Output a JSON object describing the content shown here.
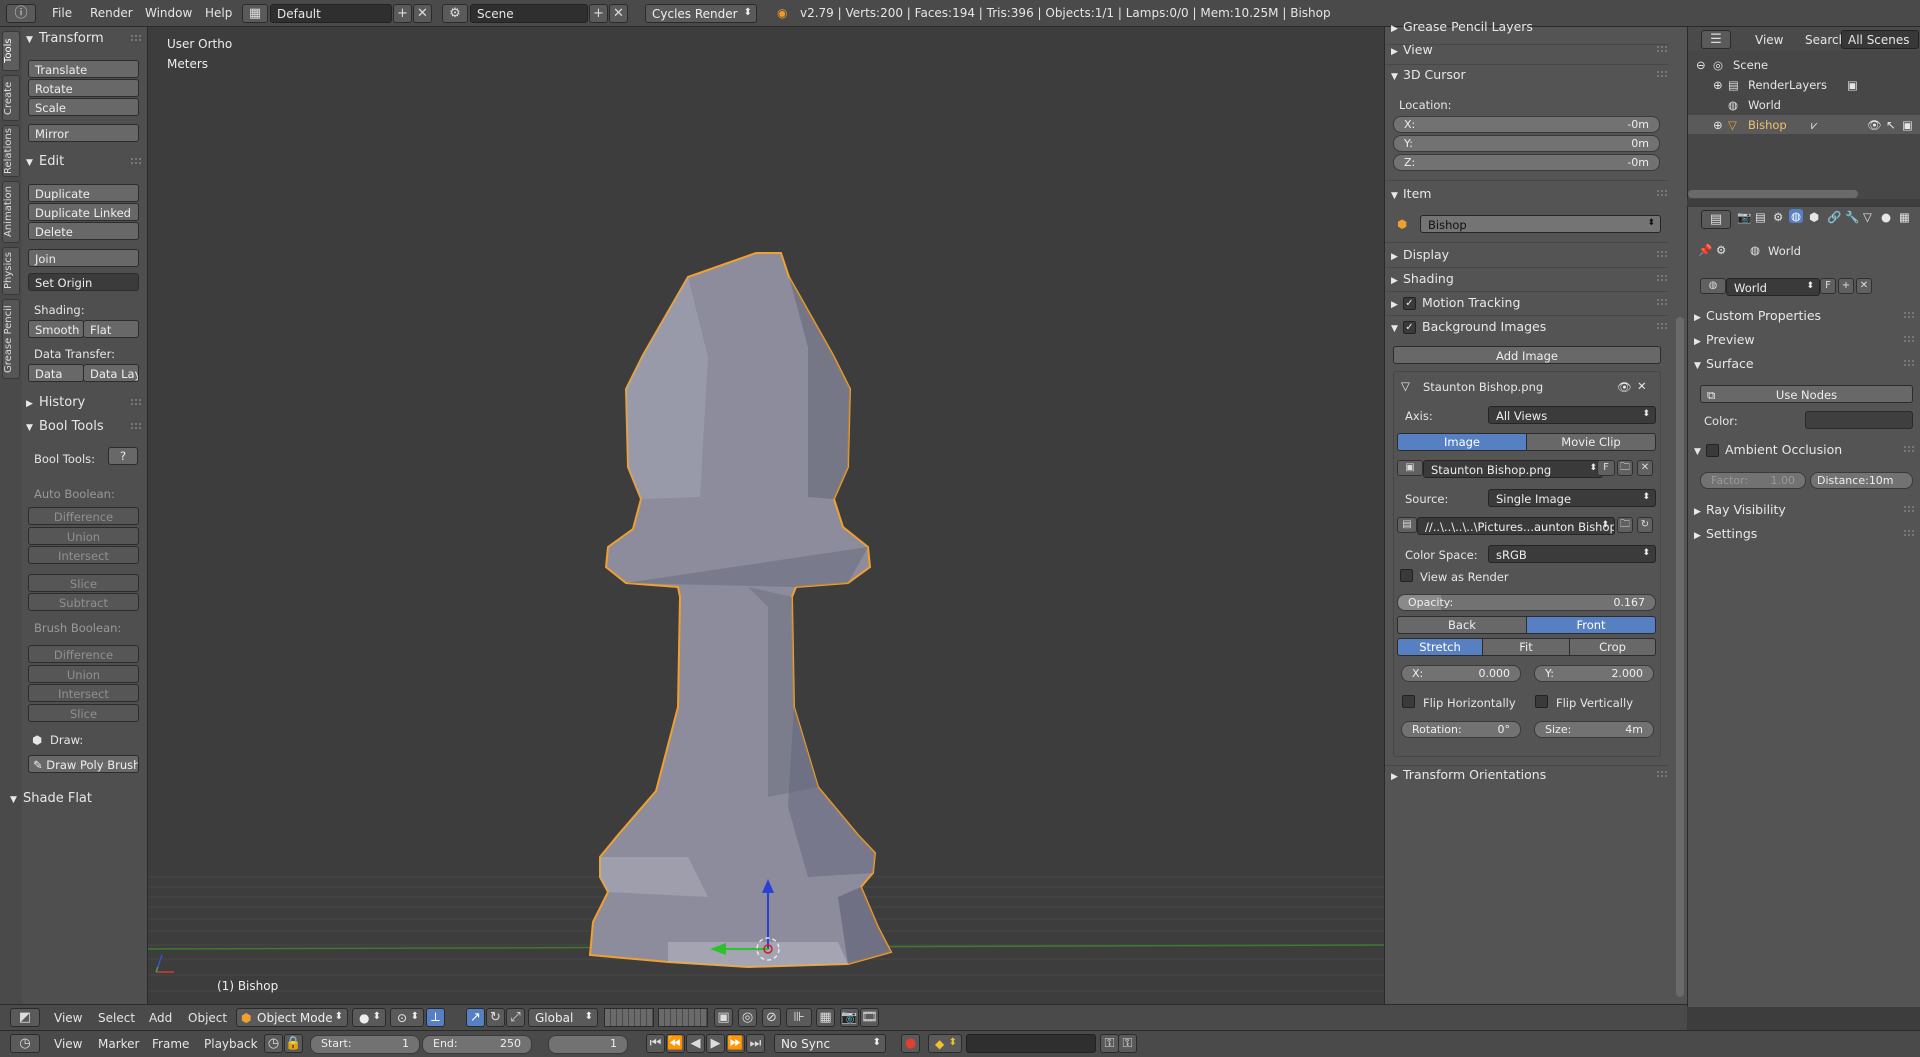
{
  "topbar": {
    "menus": [
      "File",
      "Render",
      "Window",
      "Help"
    ],
    "layout": "Default",
    "scene": "Scene",
    "engine": "Cycles Render",
    "info": "v2.79 | Verts:200 | Faces:194 | Tris:396 | Objects:1/1 | Lamps:0/0 | Mem:10.25M | Bishop"
  },
  "lefttabs": [
    "Tools",
    "Create",
    "Relations",
    "Animation",
    "Physics",
    "Grease Pencil"
  ],
  "tools": {
    "transform": {
      "title": "Transform",
      "buttons": [
        "Translate",
        "Rotate",
        "Scale",
        "Mirror"
      ]
    },
    "edit": {
      "title": "Edit",
      "buttons": [
        "Duplicate",
        "Duplicate Linked",
        "Delete",
        "Join"
      ],
      "set_origin": "Set Origin",
      "shading_label": "Shading:",
      "smooth": "Smooth",
      "flat": "Flat",
      "data_transfer_label": "Data Transfer:",
      "data": "Data",
      "data_lay": "Data Lay"
    },
    "history": "History",
    "bool_tools": {
      "title": "Bool Tools",
      "label": "Bool Tools:",
      "auto_label": "Auto Boolean:",
      "auto": [
        "Difference",
        "Union",
        "Intersect",
        "Slice",
        "Subtract"
      ],
      "brush_label": "Brush Boolean:",
      "brush": [
        "Difference",
        "Union",
        "Intersect",
        "Slice"
      ],
      "draw_label": "Draw:",
      "draw_btn": "Draw Poly Brush"
    },
    "shade_flat": "Shade Flat"
  },
  "viewport": {
    "view_name": "User Ortho",
    "units": "Meters",
    "object_label": "(1) Bishop"
  },
  "npanel": {
    "grease": "Grease Pencil Layers",
    "view": "View",
    "cursor": {
      "title": "3D Cursor",
      "location": "Location:",
      "x_label": "X:",
      "x": "-0m",
      "y_label": "Y:",
      "y": "0m",
      "z_label": "Z:",
      "z": "-0m"
    },
    "item": {
      "title": "Item",
      "name": "Bishop"
    },
    "display": "Display",
    "shading": "Shading",
    "motion": "Motion Tracking",
    "bg_images": "Background Images",
    "add_image": "Add Image",
    "bg": {
      "file": "Staunton Bishop.png",
      "axis_label": "Axis:",
      "axis": "All Views",
      "tab_image": "Image",
      "tab_clip": "Movie Clip",
      "img_name": "Staunton Bishop.png",
      "f": "F",
      "source_label": "Source:",
      "source": "Single Image",
      "path": "//..\\..\\..\\..\\Pictures...aunton Bishop.png",
      "colorspace_label": "Color Space:",
      "colorspace": "sRGB",
      "view_as_render": "View as Render",
      "opacity_label": "Opacity:",
      "opacity": "0.167",
      "back": "Back",
      "front": "Front",
      "stretch": "Stretch",
      "fit": "Fit",
      "crop": "Crop",
      "x_label": "X:",
      "x": "0.000",
      "y_label": "Y:",
      "y": "2.000",
      "flip_h": "Flip Horizontally",
      "flip_v": "Flip Vertically",
      "rotation_label": "Rotation:",
      "rotation": "0°",
      "size_label": "Size:",
      "size": "4m"
    },
    "transform_orient": "Transform Orientations"
  },
  "outliner": {
    "menus": [
      "View",
      "Search"
    ],
    "filter": "All Scenes",
    "tree": [
      "Scene",
      "RenderLayers",
      "World",
      "Bishop"
    ]
  },
  "properties": {
    "context": "World",
    "world_name": "World",
    "f": "F",
    "panels": {
      "custom": "Custom Properties",
      "preview": "Preview",
      "surface": "Surface",
      "use_nodes": "Use Nodes",
      "color_label": "Color:",
      "ao": "Ambient Occlusion",
      "factor_label": "Factor:",
      "factor": "1.00",
      "distance_label": "Distance:",
      "distance": "10m",
      "ray": "Ray Visibility",
      "settings": "Settings"
    }
  },
  "view3d_header": {
    "menus": [
      "View",
      "Select",
      "Add",
      "Object"
    ],
    "mode": "Object Mode",
    "orientation": "Global"
  },
  "timeline": {
    "menus": [
      "View",
      "Marker",
      "Frame",
      "Playback"
    ],
    "start_label": "Start:",
    "start": "1",
    "end_label": "End:",
    "end": "250",
    "current": "1",
    "sync": "No Sync"
  },
  "colors": {
    "accent": "#5680c2",
    "outline": "#f0a030",
    "bg": "#3d3d3d"
  }
}
